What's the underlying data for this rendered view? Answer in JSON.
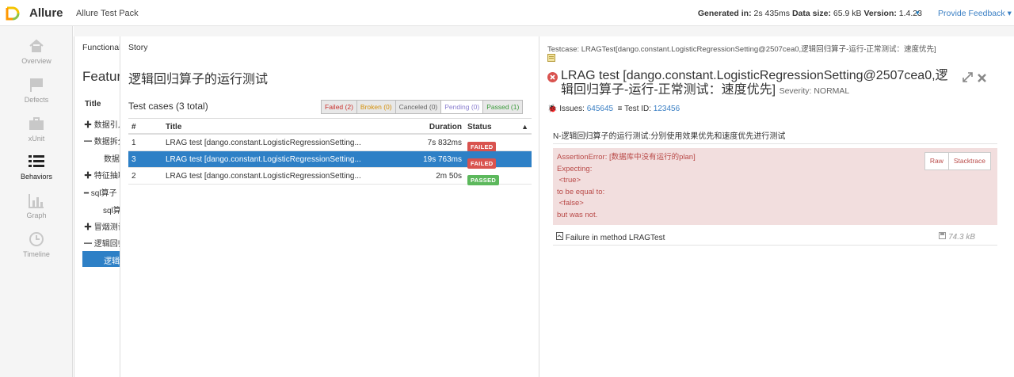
{
  "header": {
    "brand": "Allure",
    "report_name": "Allure Test Pack",
    "generated_label": "Generated in:",
    "generated_value": "2s 435ms",
    "size_label": "Data size:",
    "size_value": "65.9 kB",
    "version_label": "Version:",
    "version_value": "1.4.23",
    "feedback": "Provide Feedback",
    "caret": "▾",
    "brand_colors": {
      "yellow": "#f5c400",
      "green": "#8bc34a",
      "orange": "#ff9800"
    }
  },
  "sidebar": {
    "items": [
      {
        "label": "Overview",
        "icon": "home-icon",
        "active": false
      },
      {
        "label": "Defects",
        "icon": "flag-icon",
        "active": false
      },
      {
        "label": "xUnit",
        "icon": "briefcase-icon",
        "active": false
      },
      {
        "label": "Behaviors",
        "icon": "list-icon",
        "active": true
      },
      {
        "label": "Graph",
        "icon": "bar-chart-icon",
        "active": false
      },
      {
        "label": "Timeline",
        "icon": "clock-icon",
        "active": false
      }
    ]
  },
  "functional": {
    "label": "Functional",
    "heading": "Feature",
    "title_header": "Title",
    "rows": [
      {
        "text": "✚ 数据引入",
        "selected": false
      },
      {
        "text": "━ 数据拆分",
        "selected": false
      },
      {
        "text": "数据拆",
        "selected": false
      },
      {
        "text": "✚ 特征抽取",
        "selected": false
      },
      {
        "text": "━ sql算子",
        "selected": false
      },
      {
        "text": "sql算",
        "selected": false
      },
      {
        "text": "✚ 冒烟测试",
        "selected": false
      },
      {
        "text": "━ 逻辑回归",
        "selected": false
      },
      {
        "text": "逻辑",
        "selected": true
      }
    ]
  },
  "story": {
    "label": "Story",
    "heading": "逻辑回归算子的运行测试",
    "count": "Test cases (3 total)",
    "filters": {
      "failed": "Failed (2)",
      "broken": "Broken (0)",
      "canceled": "Canceled (0)",
      "pending": "Pending (0)",
      "passed": "Passed (1)"
    },
    "columns": {
      "num": "#",
      "title": "Title",
      "duration": "Duration",
      "status": "Status",
      "sort": "▲"
    },
    "rows": [
      {
        "num": "1",
        "title": "LRAG test [dango.constant.LogisticRegressionSetting...",
        "duration": "7s 832ms",
        "status": "FAILED",
        "selected": false
      },
      {
        "num": "3",
        "title": "LRAG test [dango.constant.LogisticRegressionSetting...",
        "duration": "19s 763ms",
        "status": "FAILED",
        "selected": true
      },
      {
        "num": "2",
        "title": "LRAG test [dango.constant.LogisticRegressionSetting...",
        "duration": "2m 50s",
        "status": "PASSED",
        "selected": false
      }
    ]
  },
  "testcase": {
    "label": "Testcase: LRAGTest[dango.constant.LogisticRegressionSetting@2507cea0,逻辑回归算子-运行-正常测试：速度优先]",
    "heading": "LRAG test [dango.constant.LogisticRegressionSetting@2507cea0,逻辑回归算子-运行-正常测试：速度优先]",
    "severity": "Severity: NORMAL",
    "issues_label": "Issues:",
    "issues_value": "645645",
    "testid_label": "Test ID:",
    "testid_value": "123456",
    "description": "N-逻辑回归算子的运行测试:分别使用效果优先和速度优先进行测试",
    "error_lines": [
      "AssertionError: [数据库中没有运行的plan]",
      "Expecting:",
      " <true>",
      "to be equal to:",
      " <false>",
      "but was not."
    ],
    "raw_button": "Raw",
    "stacktrace_button": "Stacktrace",
    "attachment_name": "Failure in method LRAGTest",
    "attachment_size": "74.3 kB"
  },
  "colors": {
    "accent": "#2e80c6",
    "failed": "#d9534f",
    "passed": "#5cb85c",
    "error_bg": "#f2dede"
  }
}
